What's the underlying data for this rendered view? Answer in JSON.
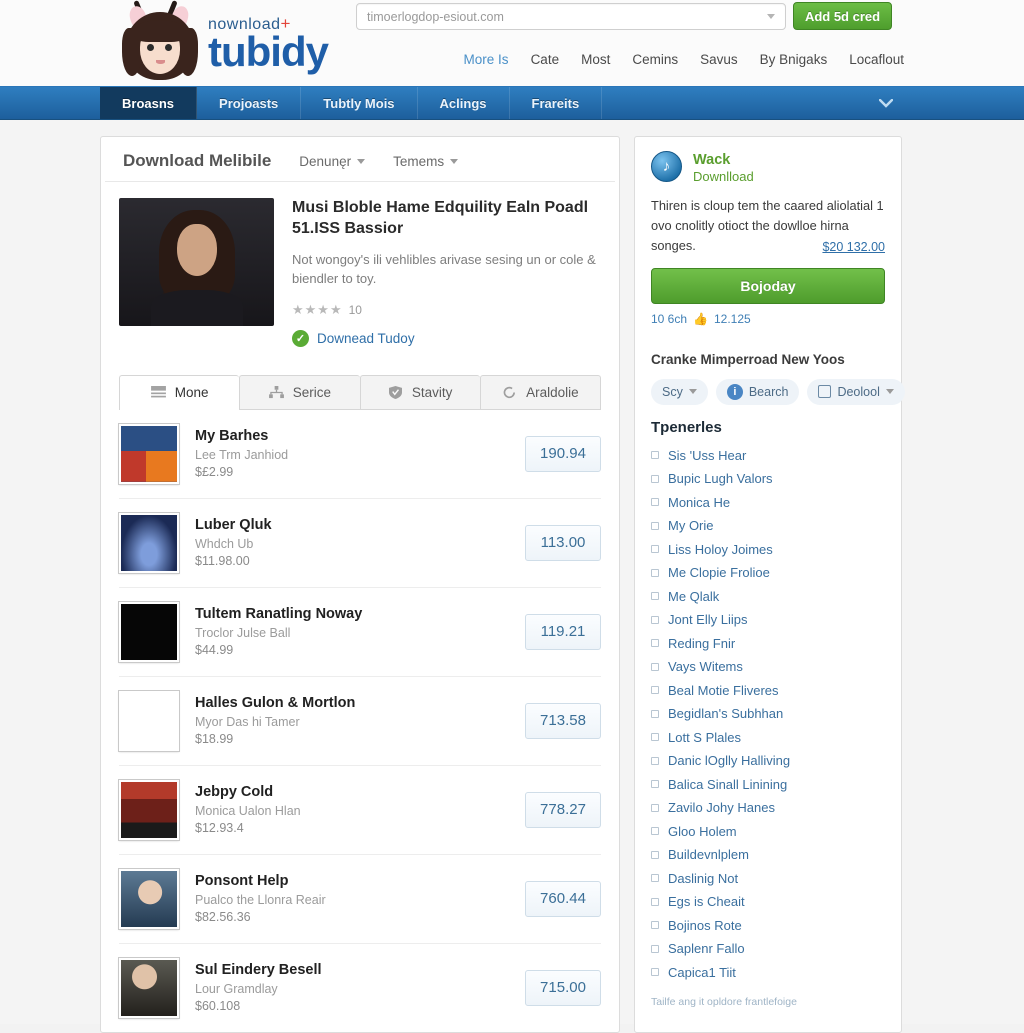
{
  "header": {
    "logo_sub": "nownload",
    "logo_plus": "+",
    "logo_main": "tubidy",
    "search_placeholder": "timoerlogdop-esiout.com",
    "search_value": "",
    "add_button": "Add 5d cred",
    "topnav": [
      {
        "label": "More Is",
        "active": true
      },
      {
        "label": "Cate",
        "active": false
      },
      {
        "label": "Most",
        "active": false
      },
      {
        "label": "Cemins",
        "active": false
      },
      {
        "label": "Savus",
        "active": false
      },
      {
        "label": "By Bnigaks",
        "active": false
      },
      {
        "label": "Locaflout",
        "active": false
      }
    ]
  },
  "bluenav": {
    "tabs": [
      {
        "label": "Broasns",
        "active": true
      },
      {
        "label": "Projoasts",
        "active": false
      },
      {
        "label": "Tubtly Mois",
        "active": false
      },
      {
        "label": "Aclings",
        "active": false
      },
      {
        "label": "Frareits",
        "active": false
      }
    ],
    "chevron": "chevron-down-icon"
  },
  "main": {
    "title": "Download Melibile",
    "dropdowns": [
      "Denunęr",
      "Temems"
    ],
    "hero": {
      "title": "Musi Bloble Hame Edquility Ealn Poadl 51.ISS Bassior",
      "description": "Not wongoy's ili vehlibles arivase sesing un or cole & biendler to toy.",
      "stars": "★★★★",
      "star_count": "10",
      "download_link": "Downead Tudoy"
    },
    "tabs": [
      {
        "label": "Mone",
        "icon": "list-icon",
        "active": true
      },
      {
        "label": "Serice",
        "icon": "sitemap-icon",
        "active": false
      },
      {
        "label": "Stavity",
        "icon": "shield-icon",
        "active": false
      },
      {
        "label": "Araldolie",
        "icon": "circle-refresh-icon",
        "active": false
      }
    ],
    "rows": [
      {
        "title": "My Barhes",
        "sub": "Lee Trm Janhiod",
        "price": "$£2.99",
        "value": "190.94"
      },
      {
        "title": "Luber Qluk",
        "sub": "Whdch Ub",
        "price": "$11.98.00",
        "value": "113.00"
      },
      {
        "title": "Tultem Ranatling Noway",
        "sub": "Troclor Julse Ball",
        "price": "$44.99",
        "value": "119.21"
      },
      {
        "title": "Halles Gulon & Mortlon",
        "sub": "Myor Das hi Tamer",
        "price": "$18.99",
        "value": "713.58"
      },
      {
        "title": "Jebpy Cold",
        "sub": "Monica Ualon Hlan",
        "price": "$12.93.4",
        "value": "778.27"
      },
      {
        "title": "Ponsont Help",
        "sub": "Pualco the Llonra Reair",
        "price": "$82.56.36",
        "value": "760.44"
      },
      {
        "title": "Sul Eindery Besell",
        "sub": "Lour Gramdlay",
        "price": "$60.108",
        "value": "715.00"
      }
    ]
  },
  "sidebar": {
    "badge_glyph": "♪",
    "title": "Wack",
    "subtitle": "Downlload",
    "description": "Thiren is cloup tem the caared aliolatial 1 ovo cnolitly otioct the dowlloe hirna songes.",
    "price": "$20 132.00",
    "cta_button": "Bojoday",
    "meta_left": "10 6ch",
    "meta_icon": "thumbs-up-icon",
    "meta_right": "12.125",
    "section_heading": "Cranke Mimperroad New Yoos",
    "pills": [
      {
        "label": "Scy",
        "icon": "none",
        "caret": true
      },
      {
        "label": "Bearch",
        "icon": "info-icon",
        "caret": false
      },
      {
        "label": "Deolool",
        "icon": "window-icon",
        "caret": true
      }
    ],
    "list_heading": "Tpenerles",
    "items": [
      "Sis 'Uss Hear",
      "Bupic Lugh Valors",
      "Monica He",
      "My Orie",
      "Liss Holoy Joimes",
      "Me Clopie Frolioe",
      "Me Qlalk",
      "Jont Elly Liips",
      "Reding Fnir",
      "Vays Witems",
      "Beal Motie Fliveres",
      "Begidlan's Subhhan",
      "Lott S Plales",
      "Danic lOglly Halliving",
      "Balica Sinall Linining",
      "Zavilo Johy Hanes",
      "Gloo Holem",
      "Buildevnlplem",
      "Daslinig Not",
      "Egs is Cheait",
      "Bojinos Rote",
      "Saplenr Fallo",
      "Capica1 Tiit"
    ],
    "footer_note": "Tailfe ang it opldore frantlefoige"
  },
  "colors": {
    "brand_blue": "#1f5ea8",
    "nav_blue": "#2f7ec0",
    "green": "#5aab35",
    "link": "#3a6f9e"
  }
}
